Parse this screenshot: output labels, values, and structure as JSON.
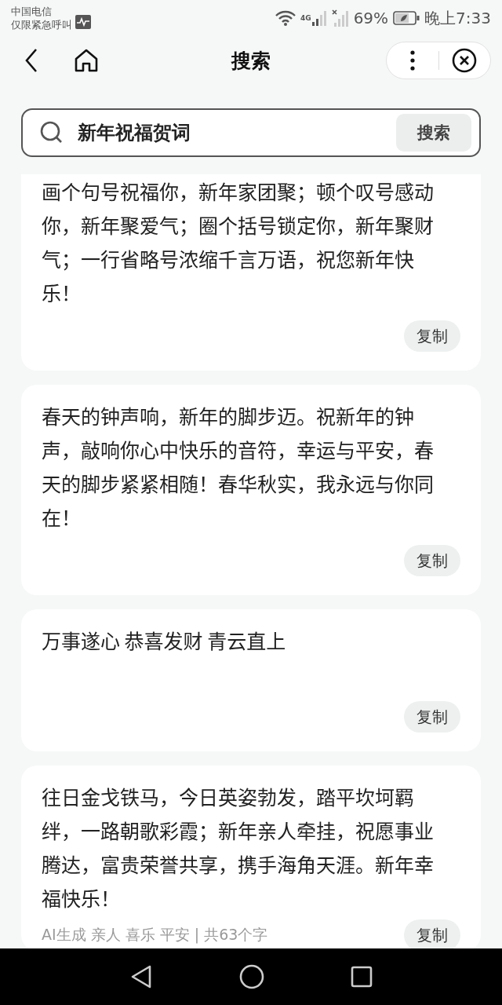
{
  "status_bar": {
    "carrier": "中国电信",
    "carrier_note": "仅限紧急呼叫",
    "network": "4G",
    "battery_text": "69%",
    "time": "晚上7:33"
  },
  "header": {
    "title": "搜索"
  },
  "search": {
    "value": "新年祝福贺词",
    "button": "搜索"
  },
  "results": [
    {
      "text": "画个句号祝福你，新年家团聚；顿个叹号感动你，新年聚爱气；圈个括号锁定你，新年聚财气；一行省略号浓缩千言万语，祝您新年快乐！",
      "copy": "复制"
    },
    {
      "text": "春天的钟声响，新年的脚步迈。祝新年的钟声，敲响你心中快乐的音符，幸运与平安，春天的脚步紧紧相随！春华秋实，我永远与你同在！",
      "copy": "复制"
    },
    {
      "text": "万事遂心 恭喜发财 青云直上",
      "copy": "复制"
    },
    {
      "text": "往日金戈铁马，今日英姿勃发，踏平坎坷羁绊，一路朝歌彩霞；新年亲人牵挂，祝愿事业腾达，富贵荣誉共享，携手海角天涯。新年幸福快乐！",
      "meta": "AI生成 亲人 喜乐 平安 | 共63个字",
      "copy": "复制"
    }
  ]
}
